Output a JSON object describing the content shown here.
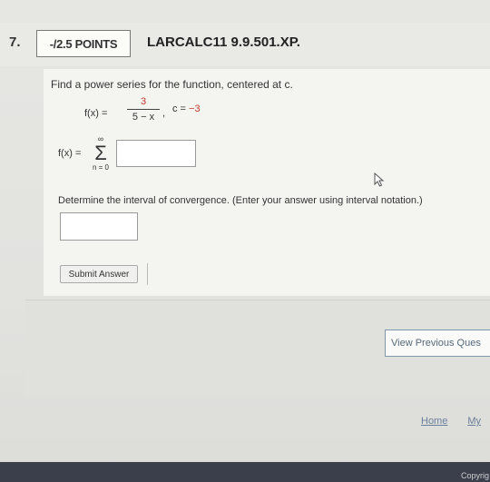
{
  "question": {
    "number": "7.",
    "points": "-/2.5 POINTS",
    "assignment_id": "LARCALC11 9.9.501.XP.",
    "prompt": "Find a power series for the function, centered at c.",
    "function_label": "f(x) =",
    "numerator": "3",
    "denominator": "5 − x",
    "comma": ",",
    "c_label": "c = ",
    "c_value": "−3",
    "series_label": "f(x) =",
    "sum_upper": "∞",
    "sum_symbol": "Σ",
    "sum_lower": "n = 0",
    "interval_instruction": "Determine the interval of convergence. (Enter your answer using interval notation.)",
    "submit_label": "Submit Answer"
  },
  "actions": {
    "view_previous": "View Previous Ques"
  },
  "footer": {
    "home": "Home",
    "my": "My"
  },
  "copyright": "Copyrig"
}
